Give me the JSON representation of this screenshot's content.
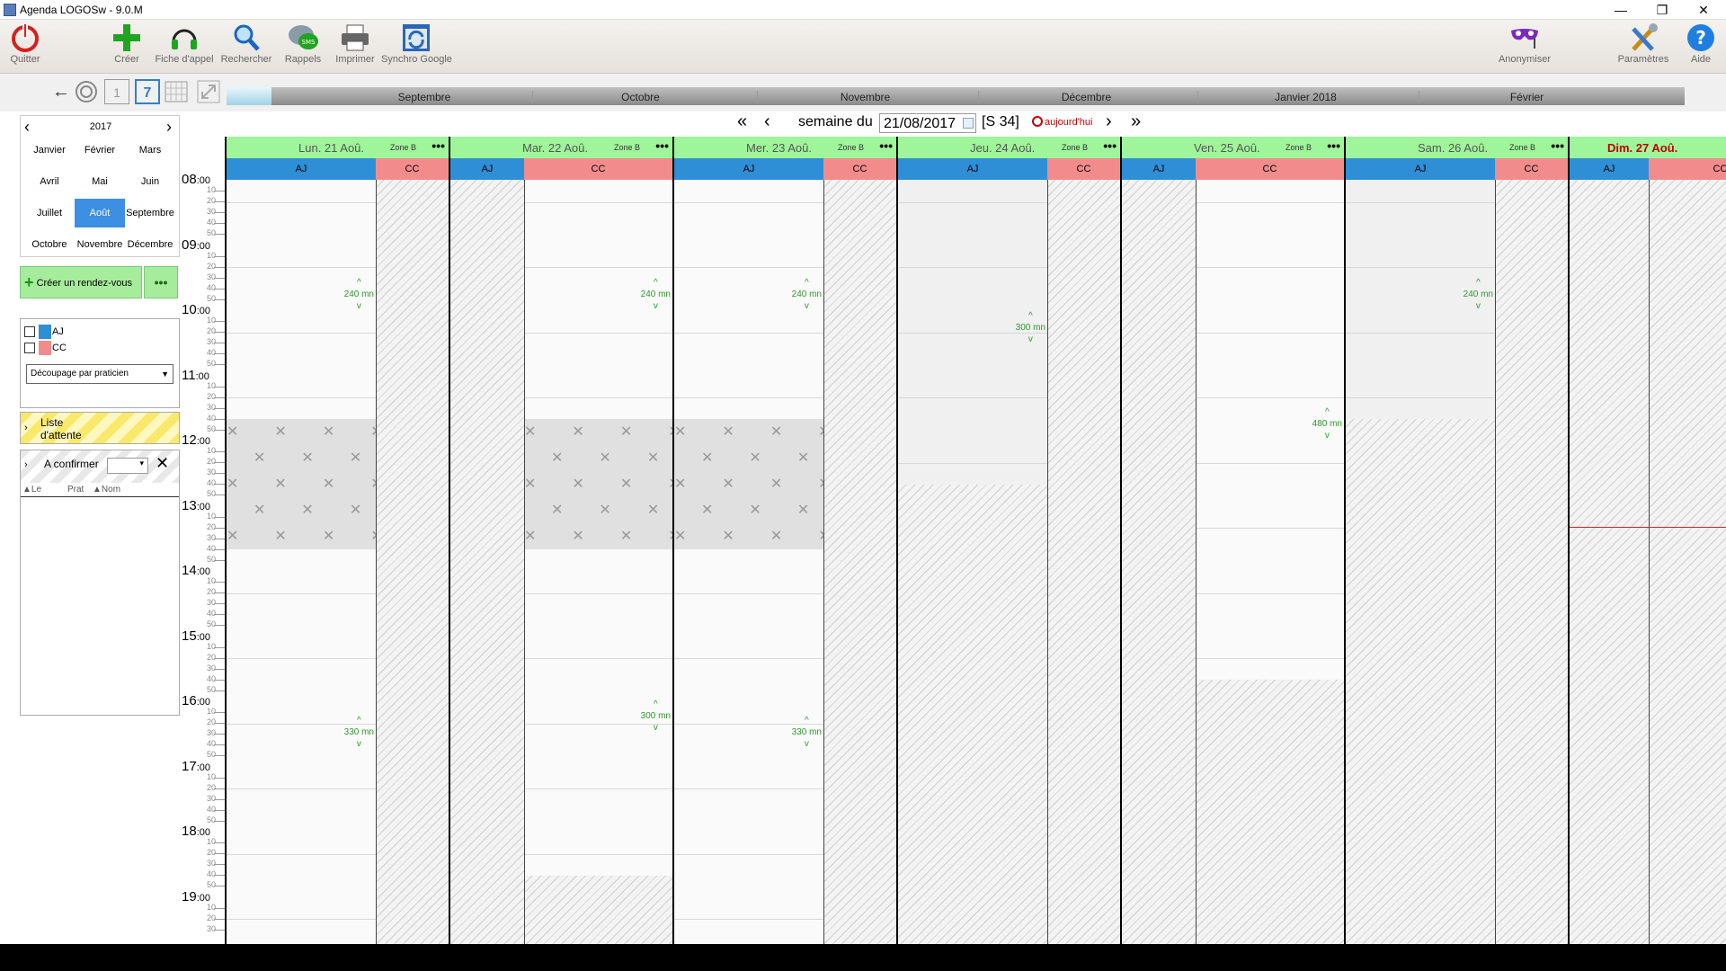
{
  "window": {
    "title": "Agenda LOGOSw - 9.0.M",
    "minimize": "—",
    "restore": "❐",
    "close": "✕"
  },
  "toolbar": {
    "quit": "Quitter",
    "create": "Créer",
    "call_sheet": "Fiche d'appel",
    "search": "Rechercher",
    "reminders": "Rappels",
    "sms": "SMS",
    "print": "Imprimer",
    "google_sync": "Synchro Google",
    "anonymize": "Anonymiser",
    "settings": "Paramètres",
    "help": "Aide",
    "help_glyph": "?"
  },
  "nav": {
    "back": "←",
    "day_badge": "1",
    "week_badge": "7"
  },
  "months_strip": [
    "Septembre",
    "Octobre",
    "Novembre",
    "Décembre",
    "Janvier 2018",
    "Février"
  ],
  "week": {
    "prev_fast": "«",
    "prev": "‹",
    "label": "semaine du",
    "date": "21/08/2017",
    "week_num": "[S 34]",
    "today": "aujourd'hui",
    "next": "›",
    "next_fast": "»"
  },
  "calendar": {
    "year": "2017",
    "prev": "‹",
    "next": "›",
    "months": [
      "Janvier",
      "Février",
      "Mars",
      "Avril",
      "Mai",
      "Juin",
      "Juillet",
      "Août",
      "Septembre",
      "Octobre",
      "Novembre",
      "Décembre"
    ],
    "selected": "Août"
  },
  "create_appointment": {
    "plus": "+",
    "label": "Créer un rendez-vous",
    "more": "•••"
  },
  "practitioners": [
    {
      "code": "AJ",
      "color": "#2e8fd6"
    },
    {
      "code": "CC",
      "color": "#f28c8c"
    }
  ],
  "decoupage": {
    "value": "Découpage par praticien",
    "arrow": "▼"
  },
  "waiting_list": {
    "chevron": "›",
    "line1": "Liste",
    "line2": "d'attente"
  },
  "to_confirm": {
    "chevron": "›",
    "label": "A confirmer",
    "arrow": "▾",
    "close": "✕",
    "col_date": "Le",
    "col_prat": "Prat",
    "col_name": "Nom"
  },
  "hours": [
    "08",
    "09",
    "10",
    "11",
    "12",
    "13",
    "14",
    "15",
    "16",
    "17",
    "18",
    "19"
  ],
  "hour_suffix": ":00",
  "minutes": [
    "10",
    "20",
    "30",
    "40",
    "50"
  ],
  "days": [
    {
      "name": "Lun. 21 Aoû.",
      "zone": "Zone B",
      "dots": "•••",
      "cols": [
        {
          "code": "AJ",
          "color": "#2e8fd6",
          "open": true,
          "lunch": true,
          "slots": [
            {
              "label": "240 mn",
              "at": 10.1
            },
            {
              "label": "330 mn",
              "at": 16.82
            }
          ]
        },
        {
          "code": "CC",
          "color": "#f28c8c",
          "open": false
        }
      ]
    },
    {
      "name": "Mar. 22 Aoû.",
      "zone": "Zone B",
      "dots": "•••",
      "cols": [
        {
          "code": "AJ",
          "color": "#2e8fd6",
          "open": false
        },
        {
          "code": "CC",
          "color": "#f28c8c",
          "open": true,
          "lunch": true,
          "closeAt": 19.0,
          "slots": [
            {
              "label": "240 mn",
              "at": 10.1
            },
            {
              "label": "300 mn",
              "at": 16.57
            }
          ]
        }
      ]
    },
    {
      "name": "Mer. 23 Aoû.",
      "zone": "Zone B",
      "dots": "•••",
      "cols": [
        {
          "code": "AJ",
          "color": "#2e8fd6",
          "open": true,
          "lunch": true,
          "slots": [
            {
              "label": "240 mn",
              "at": 10.1
            },
            {
              "label": "330 mn",
              "at": 16.82
            }
          ]
        },
        {
          "code": "CC",
          "color": "#f28c8c",
          "open": false
        }
      ]
    },
    {
      "name": "Jeu. 24 Aoû.",
      "zone": "Zone B",
      "dots": "•••",
      "cols": [
        {
          "code": "AJ",
          "color": "#2e8fd6",
          "open": true,
          "alt": true,
          "closeAt": 13.0,
          "slots": [
            {
              "label": "300 mn",
              "at": 10.6
            }
          ]
        },
        {
          "code": "CC",
          "color": "#f28c8c",
          "open": false
        }
      ]
    },
    {
      "name": "Ven. 25 Aoû.",
      "zone": "Zone B",
      "dots": "•••",
      "cols": [
        {
          "code": "AJ",
          "color": "#2e8fd6",
          "open": false
        },
        {
          "code": "CC",
          "color": "#f28c8c",
          "open": true,
          "closeAt": 16.0,
          "slots": [
            {
              "label": "480 mn",
              "at": 12.08
            }
          ]
        }
      ]
    },
    {
      "name": "Sam. 26 Aoû.",
      "zone": "Zone B",
      "dots": "•••",
      "cols": [
        {
          "code": "AJ",
          "color": "#2e8fd6",
          "open": true,
          "alt": true,
          "closeAt": 12.0,
          "slots": [
            {
              "label": "240 mn",
              "at": 10.1
            }
          ]
        },
        {
          "code": "CC",
          "color": "#f28c8c",
          "open": false
        }
      ]
    },
    {
      "name": "Dim. 27 Aoû.",
      "zone": "",
      "dots": "•••",
      "today": true,
      "cols": [
        {
          "code": "AJ",
          "color": "#2e8fd6",
          "open": false
        },
        {
          "code": "CC",
          "color": "#f28c8c",
          "open": false
        }
      ]
    }
  ],
  "colors": {
    "day_header": "#9ff59a",
    "today_text": "#c00000",
    "free_slot": "#2a9a2a",
    "now_line": "#e02020",
    "selected_month": "#3c8fe3"
  }
}
